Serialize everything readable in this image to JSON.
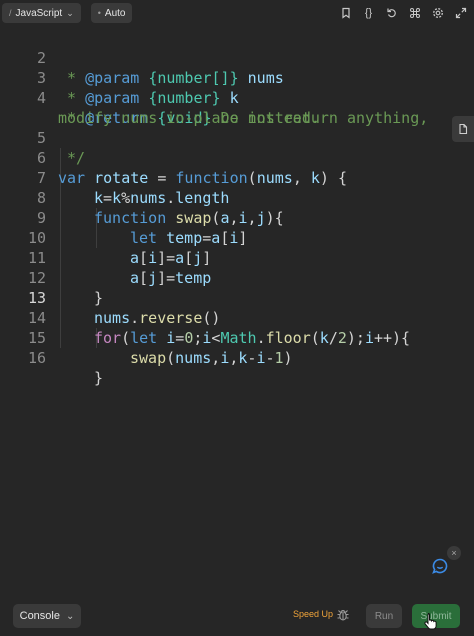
{
  "toolbar": {
    "language_prefix": "/",
    "language": "JavaScript",
    "mode_prefix": "•",
    "mode": "Auto",
    "icons": [
      "bookmark-icon",
      "braces-icon",
      "reset-icon",
      "command-icon",
      "settings-icon",
      "expand-icon"
    ],
    "braces_glyph": "{}"
  },
  "editor": {
    "active_line": "13",
    "lines": [
      {
        "n": "2"
      },
      {
        "n": "3"
      },
      {
        "n": "4"
      },
      {
        "n": "5"
      },
      {
        "n": "6"
      },
      {
        "n": "7"
      },
      {
        "n": "8"
      },
      {
        "n": "9"
      },
      {
        "n": "10"
      },
      {
        "n": "11"
      },
      {
        "n": "12"
      },
      {
        "n": "13"
      },
      {
        "n": "14"
      },
      {
        "n": "15"
      },
      {
        "n": "16"
      }
    ],
    "text": {
      "l2": [
        " * ",
        "@param",
        " ",
        "{number[]}",
        " nums"
      ],
      "l3": [
        " * ",
        "@param",
        " ",
        "{number}",
        " k"
      ],
      "l4": [
        " * ",
        "@return",
        " ",
        "{void}",
        " Do not return anything,"
      ],
      "l4b": "modify nums in-place instead.",
      "l5": " */",
      "l6": [
        "var",
        " ",
        "rotate",
        " = ",
        "function",
        "(",
        "nums",
        ", ",
        "k",
        ") {"
      ],
      "l7": [
        "k",
        "=",
        "k",
        "%",
        "nums",
        ".",
        "length"
      ],
      "l8": [
        "function",
        " ",
        "swap",
        "(",
        "a",
        ",",
        "i",
        ",",
        "j",
        "){"
      ],
      "l9": [
        "let",
        " ",
        "temp",
        "=",
        "a",
        "[",
        "i",
        "]"
      ],
      "l10": [
        "a",
        "[",
        "i",
        "]=",
        "a",
        "[",
        "j",
        "]"
      ],
      "l11": [
        "a",
        "[",
        "j",
        "]=",
        "temp"
      ],
      "l12": "}",
      "l13": [
        "nums",
        ".",
        "reverse",
        "()"
      ],
      "l14": [
        "for",
        "(",
        "let",
        " ",
        "i",
        "=",
        "0",
        ";",
        "i",
        "<",
        "Math",
        ".",
        "floor",
        "(",
        "k",
        "/",
        "2",
        ");",
        "i",
        "++){"
      ],
      "l15": [
        "swap",
        "(",
        "nums",
        ",",
        "i",
        ",",
        "k",
        "-",
        "i",
        "-",
        "1",
        ")"
      ],
      "l16": "}"
    }
  },
  "side_tab": {
    "icon": "document-icon"
  },
  "feedback": {
    "icon": "chat-icon",
    "close": "×"
  },
  "bottom": {
    "console_label": "Console",
    "console_chevron": "⌄",
    "speed_up_label": "Speed Up",
    "debug_icon": "bug-icon",
    "run_label": "Run",
    "submit_label": "Submit"
  },
  "colors": {
    "background": "#262626",
    "comment": "#6a9955",
    "keyword": "#569cd6",
    "function": "#dcdcaa",
    "variable": "#9cdcfe",
    "number": "#b5cea8",
    "class": "#4ec9b0",
    "speed_up": "#f0a43a",
    "submit_bg": "#2a6e3a"
  }
}
